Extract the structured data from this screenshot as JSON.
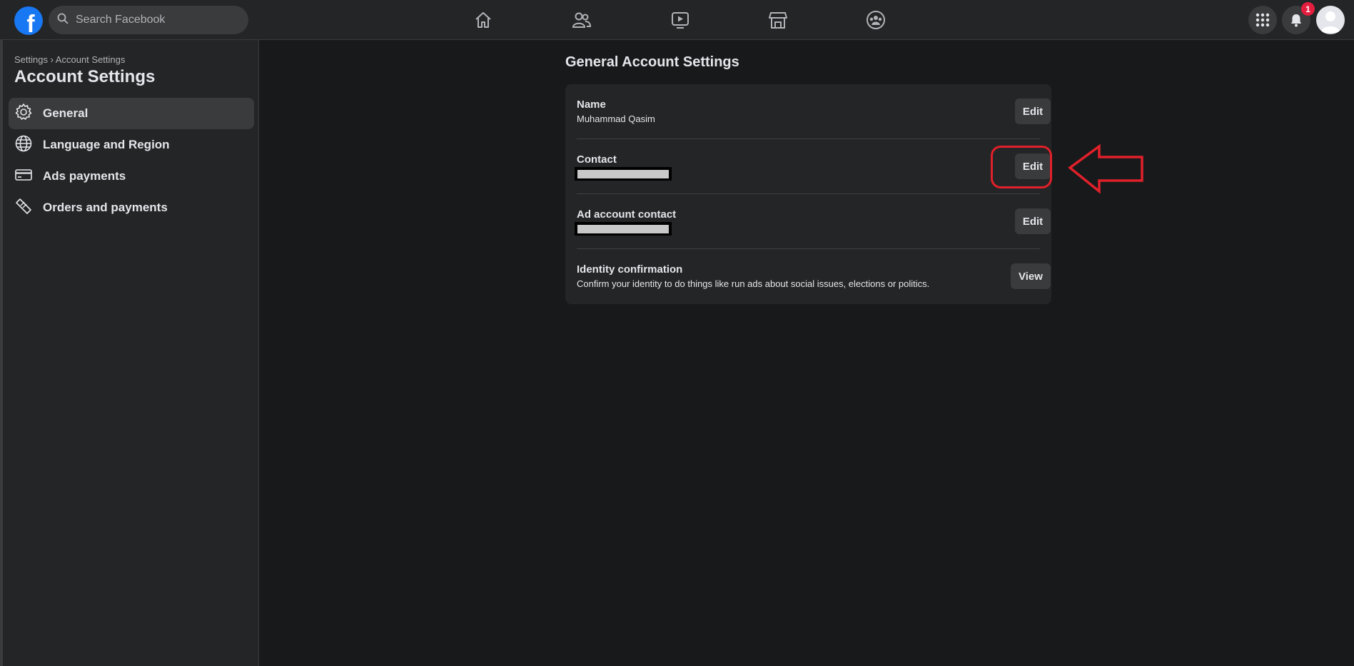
{
  "topbar": {
    "logo_letter": "f",
    "search_placeholder": "Search Facebook",
    "nav_icons": [
      "home-icon",
      "friends-icon",
      "watch-icon",
      "marketplace-icon",
      "groups-icon"
    ],
    "menu_icon": "grid-menu-icon",
    "notifications_icon": "bell-icon",
    "notification_count": "1"
  },
  "sidebar": {
    "breadcrumb": "Settings › Account Settings",
    "title": "Account Settings",
    "items": [
      {
        "label": "General",
        "icon": "gear-icon",
        "active": true
      },
      {
        "label": "Language and Region",
        "icon": "globe-icon",
        "active": false
      },
      {
        "label": "Ads payments",
        "icon": "credit-card-icon",
        "active": false
      },
      {
        "label": "Orders and payments",
        "icon": "ticket-icon",
        "active": false
      }
    ]
  },
  "main": {
    "title": "General Account Settings",
    "rows": [
      {
        "title": "Name",
        "value": "Muhammad Qasim",
        "button": "Edit"
      },
      {
        "title": "Contact",
        "value": "",
        "button": "Edit"
      },
      {
        "title": "Ad account contact",
        "value": "",
        "button": "Edit"
      },
      {
        "title": "Identity confirmation",
        "value": "Confirm your identity to do things like run ads about social issues, elections or politics.",
        "button": "View"
      }
    ]
  },
  "annotation": {
    "color": "#e0202a"
  },
  "colors": {
    "background": "#18191a",
    "surface": "#242526",
    "button": "#3a3b3c",
    "brand": "#1877f2",
    "badge": "#e41e3f"
  }
}
